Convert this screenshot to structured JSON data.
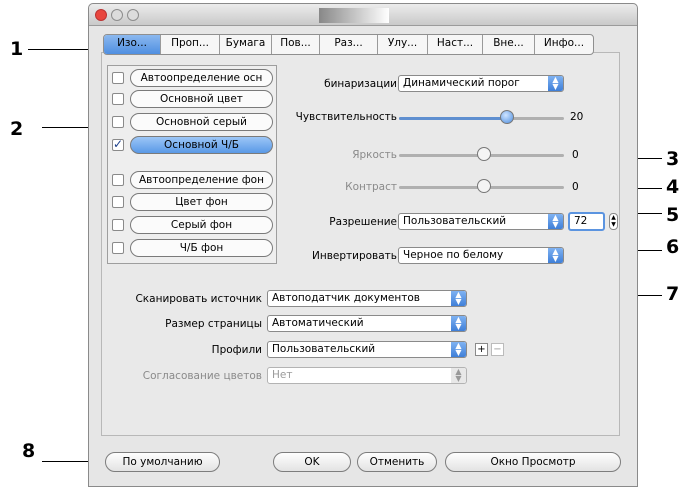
{
  "tabs": [
    "Изо...",
    "Проп...",
    "Бумага",
    "Пов...",
    "Раз...",
    "Улу...",
    "Наст...",
    "Вне...",
    "Инфо..."
  ],
  "list_items": [
    {
      "label": "Автоопределение осн",
      "checked": false,
      "selected": false
    },
    {
      "label": "Основной цвет",
      "checked": false,
      "selected": false
    },
    {
      "label": "Основной серый",
      "checked": false,
      "selected": false
    },
    {
      "label": "Основной Ч/Б",
      "checked": true,
      "selected": true
    },
    {
      "label": "Автоопределение фон",
      "checked": false,
      "selected": false
    },
    {
      "label": "Цвет фон",
      "checked": false,
      "selected": false
    },
    {
      "label": "Серый фон",
      "checked": false,
      "selected": false
    },
    {
      "label": "Ч/Б фон",
      "checked": false,
      "selected": false
    }
  ],
  "settings": {
    "binarization_label": "бинаризации",
    "binarization_value": "Динамический порог",
    "sensitivity_label": "Чувствительность",
    "sensitivity_value": "20",
    "brightness_label": "Яркость",
    "brightness_value": "0",
    "contrast_label": "Контраст",
    "contrast_value": "0",
    "resolution_label": "Разрешение",
    "resolution_value": "Пользовательский",
    "resolution_number": "72",
    "invert_label": "Инвертировать",
    "invert_value": "Черное по белому"
  },
  "source": {
    "scan_source_label": "Сканировать источник",
    "scan_source_value": "Автоподатчик документов",
    "page_size_label": "Размер страницы",
    "page_size_value": "Автоматический",
    "profiles_label": "Профили",
    "profiles_value": "Пользовательский",
    "add": "+",
    "remove": "−",
    "color_match_label": "Согласование цветов",
    "color_match_value": "Нет"
  },
  "buttons": {
    "default": "По умолчанию",
    "ok": "OK",
    "cancel": "Отменить",
    "preview": "Окно Просмотр"
  },
  "callouts": [
    "1",
    "2",
    "3",
    "4",
    "5",
    "6",
    "7",
    "8"
  ]
}
